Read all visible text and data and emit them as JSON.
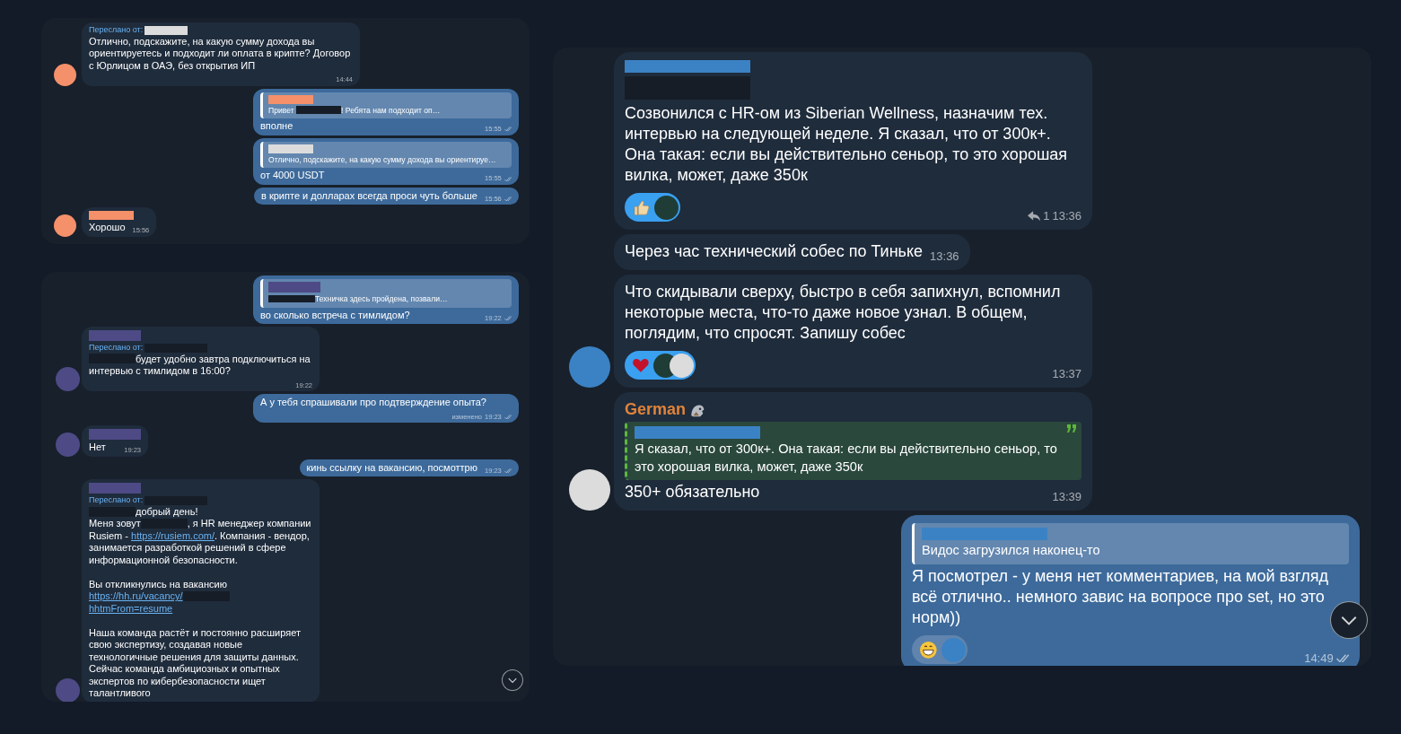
{
  "chats": [
    {
      "messages": [
        {
          "kind": "incoming",
          "avatar": {
            "color": "#f4906a"
          },
          "forward_label": "Переслано от:",
          "forward_bar": {
            "color": "#dcdcdc"
          },
          "parts": [
            {
              "kind": "text",
              "text": "Отлично, подскажите, на какую сумму дохода вы ориентируетесь и подходит ли оплата в крипте? Договор с Юрлицом в ОАЭ, без открытия ИП"
            }
          ],
          "time": "14:44"
        },
        {
          "kind": "outgoing",
          "reply": {
            "color": "#ffffff",
            "name_bar": {
              "color": "#f4906a"
            },
            "parts": [
              {
                "kind": "text",
                "text": "Привет "
              },
              {
                "kind": "redacted"
              },
              {
                "kind": "text",
                "text": "! Ребята нам подходит оп…"
              }
            ]
          },
          "parts": [
            {
              "kind": "text",
              "text": "вполне"
            }
          ],
          "time": "15:55",
          "read": true
        },
        {
          "kind": "outgoing",
          "reply": {
            "color": "#ffffff",
            "name_bar": {
              "color": "#dcdcdc"
            },
            "parts": [
              {
                "kind": "text",
                "text": "Отлично, подскажите, на какую сумму дохода вы ориентируе…"
              }
            ]
          },
          "parts": [
            {
              "kind": "text",
              "text": "от 4000 USDT"
            }
          ],
          "time": "15:55",
          "read": true
        },
        {
          "kind": "outgoing",
          "parts": [
            {
              "kind": "text",
              "text": "в крипте и долларах всегда проси чуть больше"
            }
          ],
          "time": "15:56",
          "read": true
        },
        {
          "kind": "incoming",
          "avatar": {
            "color": "#f4906a"
          },
          "name_bar": {
            "color": "#f4906a"
          },
          "parts": [
            {
              "kind": "text",
              "text": "Хорошо"
            }
          ],
          "time": "15:56"
        }
      ]
    },
    {
      "scroll_down": true,
      "messages": [
        {
          "kind": "outgoing",
          "reply": {
            "color": "#ffffff",
            "name_bar": {
              "color": "#4e4a85"
            },
            "parts": [
              {
                "kind": "redacted"
              },
              {
                "kind": "text",
                "text": "Техничка здесь пройдена, позвали…"
              }
            ]
          },
          "parts": [
            {
              "kind": "text",
              "text": "во сколько встреча с тимлидом?"
            }
          ],
          "time": "19:22",
          "read": true
        },
        {
          "kind": "incoming",
          "avatar": {
            "color": "#4e4a85"
          },
          "name_bar": {
            "color": "#4e4a85"
          },
          "forward_label": "Переслано от:",
          "forward_bar": {
            "color": "#161d27"
          },
          "parts": [
            {
              "kind": "redacted"
            },
            {
              "kind": "text",
              "text": "будет удобно завтра подключиться на интервью с тимлидом в 16:00?"
            }
          ],
          "time": "19:22"
        },
        {
          "kind": "outgoing",
          "parts": [
            {
              "kind": "text",
              "text": "А у тебя спрашивали про подтверждение опыта?"
            }
          ],
          "edited": "изменено",
          "time": "19:23",
          "read": true
        },
        {
          "kind": "incoming",
          "avatar": {
            "color": "#4e4a85"
          },
          "name_bar": {
            "color": "#4e4a85"
          },
          "parts": [
            {
              "kind": "text",
              "text": "Нет"
            }
          ],
          "time": "19:23"
        },
        {
          "kind": "outgoing",
          "parts": [
            {
              "kind": "text",
              "text": "кинь ссылку на вакансию, посмоттрю"
            }
          ],
          "time": "19:23",
          "read": true
        },
        {
          "kind": "incoming",
          "avatar": {
            "color": "#4e4a85"
          },
          "name_bar": {
            "color": "#4e4a85"
          },
          "forward_label": "Переслано от:",
          "forward_bar": {
            "color": "#161d27"
          },
          "parts": [
            {
              "kind": "redacted"
            },
            {
              "kind": "text",
              "text": "добрый день!\nМеня зовут"
            },
            {
              "kind": "redacted"
            },
            {
              "kind": "text",
              "text": ", я HR менеджер компании Rusiem - "
            },
            {
              "kind": "link",
              "text": "https://rusiem.com/"
            },
            {
              "kind": "text",
              "text": ". Компания - вендор, занимается разработкой решений в сфере информационной безопасности.\n\nВы откликнулись на вакансию "
            },
            {
              "kind": "link",
              "text": "https://hh.ru/vacancy/"
            },
            {
              "kind": "redacted"
            },
            {
              "kind": "link",
              "text": "hhtmFrom=resume"
            },
            {
              "kind": "text",
              "text": "\n\nНаша команда растёт и постоянно расширяет свою экспертизу, создавая новые технологичные решения для защиты данных. Сейчас команда амбициозных и опытных экспертов по кибербезопасности ищет талантливого"
            }
          ]
        }
      ]
    },
    {
      "scroll_down": true,
      "messages": [
        {
          "kind": "incoming",
          "name_bar": {
            "color": "#3b82c4"
          },
          "parts": [
            {
              "kind": "redacted_line"
            },
            {
              "kind": "text",
              "text": "Созвонился с HR-ом из Siberian Wellness, назначим тех. интервью на следующей неделе. Я сказал, что от 300к+. Она такая: если вы действительно сеньор, то это хорошая вилка, может, даже 350к"
            }
          ],
          "reactions": [
            {
              "kind": "thumbs_up",
              "selected": true,
              "users": [
                {
                  "color": "#1f3d36"
                }
              ]
            }
          ],
          "replies": "1",
          "time": "13:36"
        },
        {
          "kind": "incoming",
          "parts": [
            {
              "kind": "text",
              "text": "Через час технический собес по Тиньке"
            }
          ],
          "time": "13:36"
        },
        {
          "kind": "incoming",
          "avatar": {
            "color": "#3b82c4"
          },
          "parts": [
            {
              "kind": "text",
              "text": "Что скидывали сверху, быстро в себя запихнул, вспомнил некоторые места, что-то даже новое узнал. В общем, поглядим, что спросят. Запишу собес"
            }
          ],
          "reactions": [
            {
              "kind": "heart",
              "selected": true,
              "users": [
                {
                  "color": "#1f3d36"
                },
                {
                  "color": "#dcdcdc"
                }
              ]
            }
          ],
          "time": "13:37"
        },
        {
          "kind": "incoming",
          "avatar": {
            "color": "#dcdcdc"
          },
          "sender": "German",
          "reply": {
            "color": "#5cb83a",
            "name_bar": {
              "color": "#3b82c4"
            },
            "parts": [
              {
                "kind": "text",
                "text": "Я сказал, что от 300к+. Она такая: если вы действительно сеньор, то это хорошая вилка, может, даже 350к"
              }
            ]
          },
          "parts": [
            {
              "kind": "text",
              "text": "350+ обязательно"
            }
          ],
          "time": "13:39"
        },
        {
          "kind": "outgoing",
          "reply": {
            "color": "#ffffff",
            "name_bar": {
              "color": "#3b82c4"
            },
            "parts": [
              {
                "kind": "text",
                "text": "Видос загрузился наконец-то"
              }
            ]
          },
          "parts": [
            {
              "kind": "text",
              "text": "Я посмотрел - у меня нет комментариев, на мой взгляд всё отлично.. немного завис на вопросе про set, но это норм))"
            }
          ],
          "reactions": [
            {
              "kind": "grin",
              "selected": false,
              "users": [
                {
                  "color": "#3b82c4"
                }
              ]
            }
          ],
          "time": "14:49",
          "read": true
        }
      ]
    }
  ]
}
